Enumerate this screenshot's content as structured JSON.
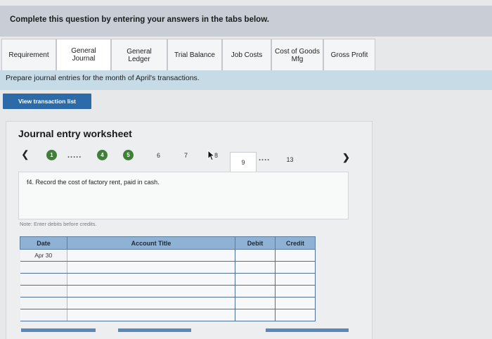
{
  "header": {
    "title": "Complete this question by entering your answers in the tabs below."
  },
  "tabs": [
    {
      "label": "Requirement",
      "active": false
    },
    {
      "label": "General\nJournal",
      "active": true
    },
    {
      "label": "General\nLedger",
      "active": false
    },
    {
      "label": "Trial Balance",
      "active": false
    },
    {
      "label": "Job Costs",
      "active": false
    },
    {
      "label": "Cost of Goods\nMfg",
      "active": false
    },
    {
      "label": "Gross Profit",
      "active": false
    }
  ],
  "instruction": "Prepare journal entries for the month of April's transactions.",
  "view_button": "View transaction list",
  "worksheet": {
    "title": "Journal entry worksheet",
    "prev_icon": "chevron-left-icon",
    "next_icon": "chevron-right-icon",
    "steps": {
      "s1": "1",
      "dots1": ".....",
      "s4": "4",
      "s5": "5",
      "s6": "6",
      "s7": "7",
      "s8": "8",
      "s9": "9",
      "dots2": "....",
      "s13": "13"
    },
    "description": "f4. Record the cost of factory rent, paid in cash.",
    "note": "Note: Enter debits before credits.",
    "completed_color": "#3f7f37"
  },
  "table": {
    "headers": [
      "Date",
      "Account Title",
      "Debit",
      "Credit"
    ],
    "rows": [
      [
        "Apr 30",
        "",
        "",
        ""
      ],
      [
        "",
        "",
        "",
        ""
      ],
      [
        "",
        "",
        "",
        ""
      ],
      [
        "",
        "",
        "",
        ""
      ],
      [
        "",
        "",
        "",
        ""
      ],
      [
        "",
        "",
        "",
        ""
      ]
    ]
  },
  "colors": {
    "accent": "#2d6aa8",
    "table_header": "#8fb1d4"
  }
}
